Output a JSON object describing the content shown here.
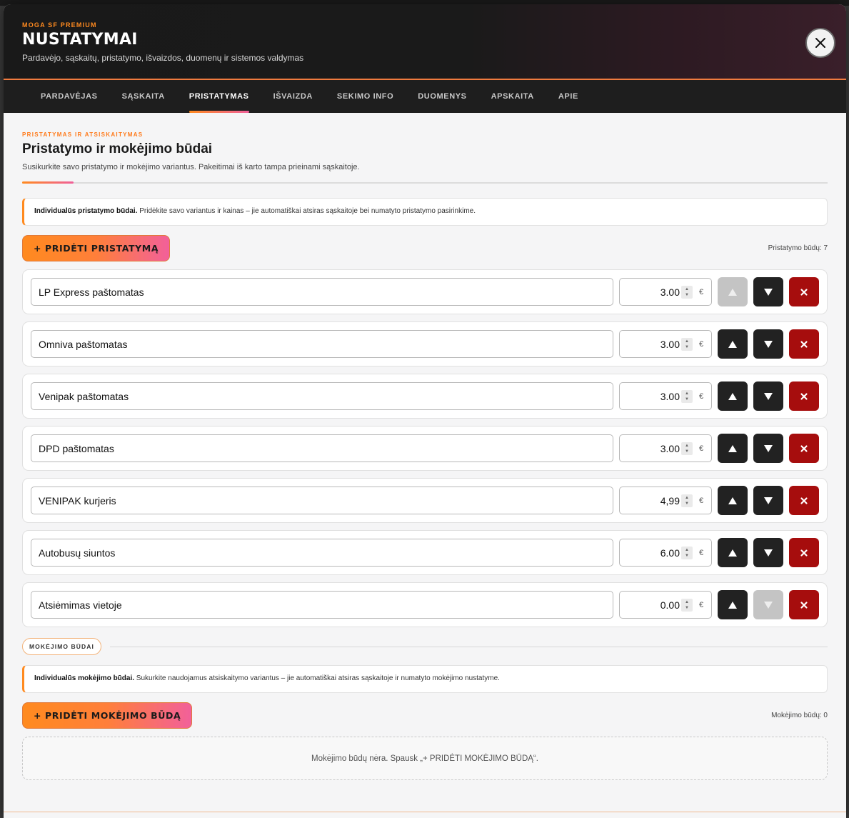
{
  "header": {
    "eyebrow": "MOGA SF PREMIUM",
    "title": "NUSTATYMAI",
    "subtitle": "Pardavėjo, sąskaitų, pristatymo, išvaizdos, duomenų ir sistemos valdymas",
    "close_icon": "close-icon"
  },
  "tabs": [
    {
      "label": "PARDAVĖJAS",
      "active": false
    },
    {
      "label": "SĄSKAITA",
      "active": false
    },
    {
      "label": "PRISTATYMAS",
      "active": true
    },
    {
      "label": "IŠVAIZDA",
      "active": false
    },
    {
      "label": "SEKIMO INFO",
      "active": false
    },
    {
      "label": "DUOMENYS",
      "active": false
    },
    {
      "label": "APSKAITA",
      "active": false
    },
    {
      "label": "APIE",
      "active": false
    }
  ],
  "section": {
    "eyebrow": "PRISTATYMAS IR ATSISKAITYMAS",
    "title": "Pristatymo ir mokėjimo būdai",
    "description": "Susikurkite savo pristatymo ir mokėjimo variantus. Pakeitimai iš karto tampa prieinami sąskaitoje."
  },
  "delivery": {
    "info_bold": "Individualūs pristatymo būdai.",
    "info_text": " Pridėkite savo variantus ir kainas – jie automatiškai atsiras sąskaitoje bei numatyto pristatymo pasirinkime.",
    "add_label": "+ PRIDĖTI PRISTATYMĄ",
    "count_label": "Pristatymo būdų: 7",
    "currency": "€",
    "items": [
      {
        "name": "LP Express paštomatas",
        "price": "3.00",
        "up_enabled": false,
        "down_enabled": true
      },
      {
        "name": "Omniva paštomatas",
        "price": "3.00",
        "up_enabled": true,
        "down_enabled": true
      },
      {
        "name": "Venipak paštomatas",
        "price": "3.00",
        "up_enabled": true,
        "down_enabled": true
      },
      {
        "name": "DPD paštomatas",
        "price": "3.00",
        "up_enabled": true,
        "down_enabled": true
      },
      {
        "name": "VENIPAK kurjeris",
        "price": "4,99",
        "up_enabled": true,
        "down_enabled": true
      },
      {
        "name": "Autobusų siuntos",
        "price": "6.00",
        "up_enabled": true,
        "down_enabled": true
      },
      {
        "name": "Atsiėmimas vietoje",
        "price": "0.00",
        "up_enabled": true,
        "down_enabled": false
      }
    ]
  },
  "payment": {
    "pill_label": "MOKĖJIMO BŪDAI",
    "info_bold": "Individualūs mokėjimo būdai.",
    "info_text": " Sukurkite naudojamus atsiskaitymo variantus – jie automatiškai atsiras sąskaitoje ir numatyto mokėjimo nustatyme.",
    "add_label": "+ PRIDĖTI MOKĖJIMO BŪDĄ",
    "count_label": "Mokėjimo būdų: 0",
    "empty_text": "Mokėjimo būdų nėra. Spausk „+ PRIDĖTI MOKĖJIMO BŪDĄ“."
  },
  "colors": {
    "accent_orange": "#ff8a1f",
    "accent_pink": "#f0609a",
    "delete_red": "#a60d0d",
    "dark_button": "#222222"
  }
}
